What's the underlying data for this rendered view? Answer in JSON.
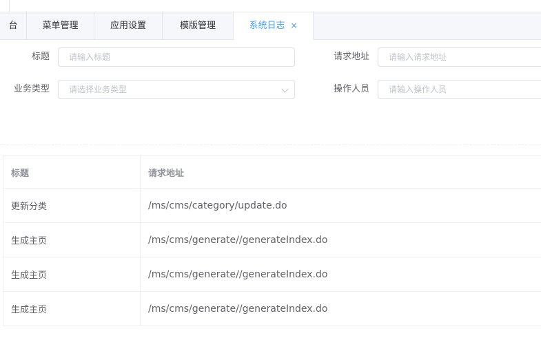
{
  "tabs": [
    {
      "label": "台"
    },
    {
      "label": "菜单管理"
    },
    {
      "label": "应用设置"
    },
    {
      "label": "模版管理"
    },
    {
      "label": "系统日志",
      "close": "×"
    }
  ],
  "form": {
    "title_label": "标题",
    "title_placeholder": "请输入标题",
    "url_label": "请求地址",
    "url_placeholder": "请输入请求地址",
    "biz_label": "业务类型",
    "biz_placeholder": "请选择业务类型",
    "operator_label": "操作人员",
    "operator_placeholder": "请输入操作人员"
  },
  "table": {
    "headers": [
      "标题",
      "请求地址"
    ],
    "rows": [
      [
        "更新分类",
        "/ms/cms/category/update.do"
      ],
      [
        "生成主页",
        "/ms/cms/generate//generateIndex.do"
      ],
      [
        "生成主页",
        "/ms/cms/generate//generateIndex.do"
      ],
      [
        "生成主页",
        "/ms/cms/generate//generateIndex.do"
      ]
    ]
  },
  "colors": {
    "accent": "#409eff",
    "border": "#dcdfe6"
  }
}
